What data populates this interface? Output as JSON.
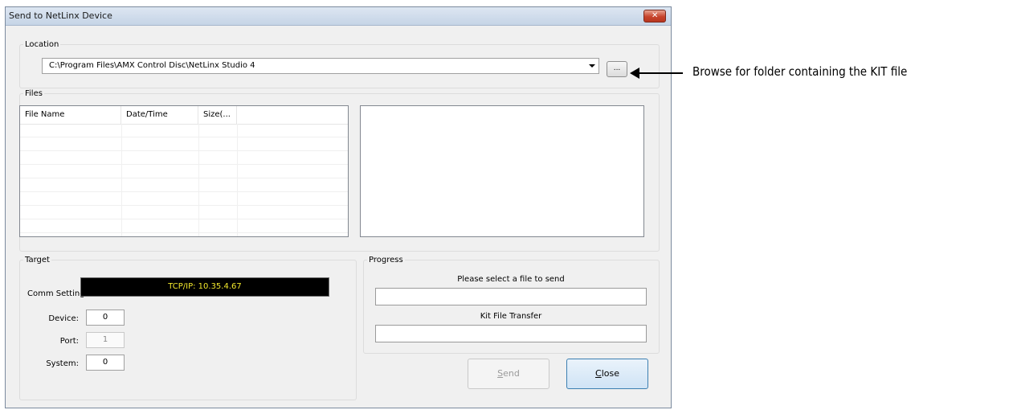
{
  "window": {
    "title": "Send to NetLinx Device"
  },
  "location": {
    "legend": "Location",
    "path": "C:\\Program Files\\AMX Control Disc\\NetLinx Studio 4",
    "browse_label": "..."
  },
  "files": {
    "legend": "Files",
    "columns": [
      "File Name",
      "Date/Time",
      "Size(...",
      ""
    ],
    "rows": []
  },
  "target": {
    "legend": "Target",
    "comm_label": "Comm Setting:",
    "comm_value": "TCP/IP: 10.35.4.67",
    "device_label": "Device:",
    "device_value": "0",
    "port_label": "Port:",
    "port_value": "1",
    "system_label": "System:",
    "system_value": "0"
  },
  "progress": {
    "legend": "Progress",
    "status_text": "Please select a file to send",
    "kit_label": "Kit File Transfer"
  },
  "buttons": {
    "send_mnemonic": "S",
    "send_rest": "end",
    "close_mnemonic": "C",
    "close_rest": "lose"
  },
  "annotation": {
    "text": "Browse for folder containing the KIT file"
  },
  "colors": {
    "comm_bg": "#000000",
    "comm_text": "#f2e82c",
    "close_accent": "#3c7fb1"
  }
}
